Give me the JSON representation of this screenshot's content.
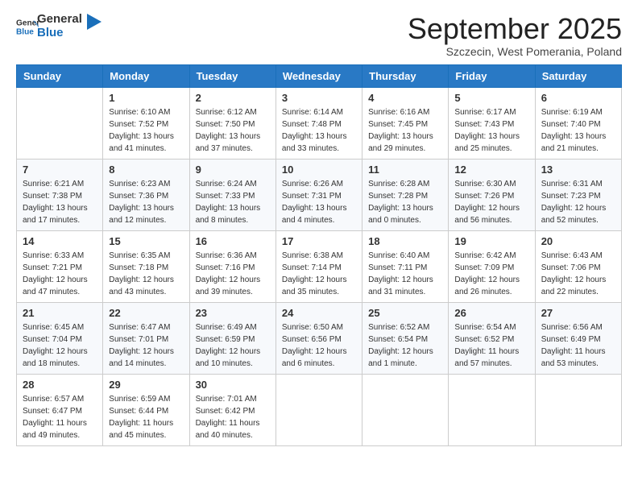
{
  "header": {
    "logo_line1": "General",
    "logo_line2": "Blue",
    "month": "September 2025",
    "location": "Szczecin, West Pomerania, Poland"
  },
  "weekdays": [
    "Sunday",
    "Monday",
    "Tuesday",
    "Wednesday",
    "Thursday",
    "Friday",
    "Saturday"
  ],
  "weeks": [
    [
      {
        "day": "",
        "sunrise": "",
        "sunset": "",
        "daylight": ""
      },
      {
        "day": "1",
        "sunrise": "Sunrise: 6:10 AM",
        "sunset": "Sunset: 7:52 PM",
        "daylight": "Daylight: 13 hours and 41 minutes."
      },
      {
        "day": "2",
        "sunrise": "Sunrise: 6:12 AM",
        "sunset": "Sunset: 7:50 PM",
        "daylight": "Daylight: 13 hours and 37 minutes."
      },
      {
        "day": "3",
        "sunrise": "Sunrise: 6:14 AM",
        "sunset": "Sunset: 7:48 PM",
        "daylight": "Daylight: 13 hours and 33 minutes."
      },
      {
        "day": "4",
        "sunrise": "Sunrise: 6:16 AM",
        "sunset": "Sunset: 7:45 PM",
        "daylight": "Daylight: 13 hours and 29 minutes."
      },
      {
        "day": "5",
        "sunrise": "Sunrise: 6:17 AM",
        "sunset": "Sunset: 7:43 PM",
        "daylight": "Daylight: 13 hours and 25 minutes."
      },
      {
        "day": "6",
        "sunrise": "Sunrise: 6:19 AM",
        "sunset": "Sunset: 7:40 PM",
        "daylight": "Daylight: 13 hours and 21 minutes."
      }
    ],
    [
      {
        "day": "7",
        "sunrise": "Sunrise: 6:21 AM",
        "sunset": "Sunset: 7:38 PM",
        "daylight": "Daylight: 13 hours and 17 minutes."
      },
      {
        "day": "8",
        "sunrise": "Sunrise: 6:23 AM",
        "sunset": "Sunset: 7:36 PM",
        "daylight": "Daylight: 13 hours and 12 minutes."
      },
      {
        "day": "9",
        "sunrise": "Sunrise: 6:24 AM",
        "sunset": "Sunset: 7:33 PM",
        "daylight": "Daylight: 13 hours and 8 minutes."
      },
      {
        "day": "10",
        "sunrise": "Sunrise: 6:26 AM",
        "sunset": "Sunset: 7:31 PM",
        "daylight": "Daylight: 13 hours and 4 minutes."
      },
      {
        "day": "11",
        "sunrise": "Sunrise: 6:28 AM",
        "sunset": "Sunset: 7:28 PM",
        "daylight": "Daylight: 13 hours and 0 minutes."
      },
      {
        "day": "12",
        "sunrise": "Sunrise: 6:30 AM",
        "sunset": "Sunset: 7:26 PM",
        "daylight": "Daylight: 12 hours and 56 minutes."
      },
      {
        "day": "13",
        "sunrise": "Sunrise: 6:31 AM",
        "sunset": "Sunset: 7:23 PM",
        "daylight": "Daylight: 12 hours and 52 minutes."
      }
    ],
    [
      {
        "day": "14",
        "sunrise": "Sunrise: 6:33 AM",
        "sunset": "Sunset: 7:21 PM",
        "daylight": "Daylight: 12 hours and 47 minutes."
      },
      {
        "day": "15",
        "sunrise": "Sunrise: 6:35 AM",
        "sunset": "Sunset: 7:18 PM",
        "daylight": "Daylight: 12 hours and 43 minutes."
      },
      {
        "day": "16",
        "sunrise": "Sunrise: 6:36 AM",
        "sunset": "Sunset: 7:16 PM",
        "daylight": "Daylight: 12 hours and 39 minutes."
      },
      {
        "day": "17",
        "sunrise": "Sunrise: 6:38 AM",
        "sunset": "Sunset: 7:14 PM",
        "daylight": "Daylight: 12 hours and 35 minutes."
      },
      {
        "day": "18",
        "sunrise": "Sunrise: 6:40 AM",
        "sunset": "Sunset: 7:11 PM",
        "daylight": "Daylight: 12 hours and 31 minutes."
      },
      {
        "day": "19",
        "sunrise": "Sunrise: 6:42 AM",
        "sunset": "Sunset: 7:09 PM",
        "daylight": "Daylight: 12 hours and 26 minutes."
      },
      {
        "day": "20",
        "sunrise": "Sunrise: 6:43 AM",
        "sunset": "Sunset: 7:06 PM",
        "daylight": "Daylight: 12 hours and 22 minutes."
      }
    ],
    [
      {
        "day": "21",
        "sunrise": "Sunrise: 6:45 AM",
        "sunset": "Sunset: 7:04 PM",
        "daylight": "Daylight: 12 hours and 18 minutes."
      },
      {
        "day": "22",
        "sunrise": "Sunrise: 6:47 AM",
        "sunset": "Sunset: 7:01 PM",
        "daylight": "Daylight: 12 hours and 14 minutes."
      },
      {
        "day": "23",
        "sunrise": "Sunrise: 6:49 AM",
        "sunset": "Sunset: 6:59 PM",
        "daylight": "Daylight: 12 hours and 10 minutes."
      },
      {
        "day": "24",
        "sunrise": "Sunrise: 6:50 AM",
        "sunset": "Sunset: 6:56 PM",
        "daylight": "Daylight: 12 hours and 6 minutes."
      },
      {
        "day": "25",
        "sunrise": "Sunrise: 6:52 AM",
        "sunset": "Sunset: 6:54 PM",
        "daylight": "Daylight: 12 hours and 1 minute."
      },
      {
        "day": "26",
        "sunrise": "Sunrise: 6:54 AM",
        "sunset": "Sunset: 6:52 PM",
        "daylight": "Daylight: 11 hours and 57 minutes."
      },
      {
        "day": "27",
        "sunrise": "Sunrise: 6:56 AM",
        "sunset": "Sunset: 6:49 PM",
        "daylight": "Daylight: 11 hours and 53 minutes."
      }
    ],
    [
      {
        "day": "28",
        "sunrise": "Sunrise: 6:57 AM",
        "sunset": "Sunset: 6:47 PM",
        "daylight": "Daylight: 11 hours and 49 minutes."
      },
      {
        "day": "29",
        "sunrise": "Sunrise: 6:59 AM",
        "sunset": "Sunset: 6:44 PM",
        "daylight": "Daylight: 11 hours and 45 minutes."
      },
      {
        "day": "30",
        "sunrise": "Sunrise: 7:01 AM",
        "sunset": "Sunset: 6:42 PM",
        "daylight": "Daylight: 11 hours and 40 minutes."
      },
      {
        "day": "",
        "sunrise": "",
        "sunset": "",
        "daylight": ""
      },
      {
        "day": "",
        "sunrise": "",
        "sunset": "",
        "daylight": ""
      },
      {
        "day": "",
        "sunrise": "",
        "sunset": "",
        "daylight": ""
      },
      {
        "day": "",
        "sunrise": "",
        "sunset": "",
        "daylight": ""
      }
    ]
  ]
}
